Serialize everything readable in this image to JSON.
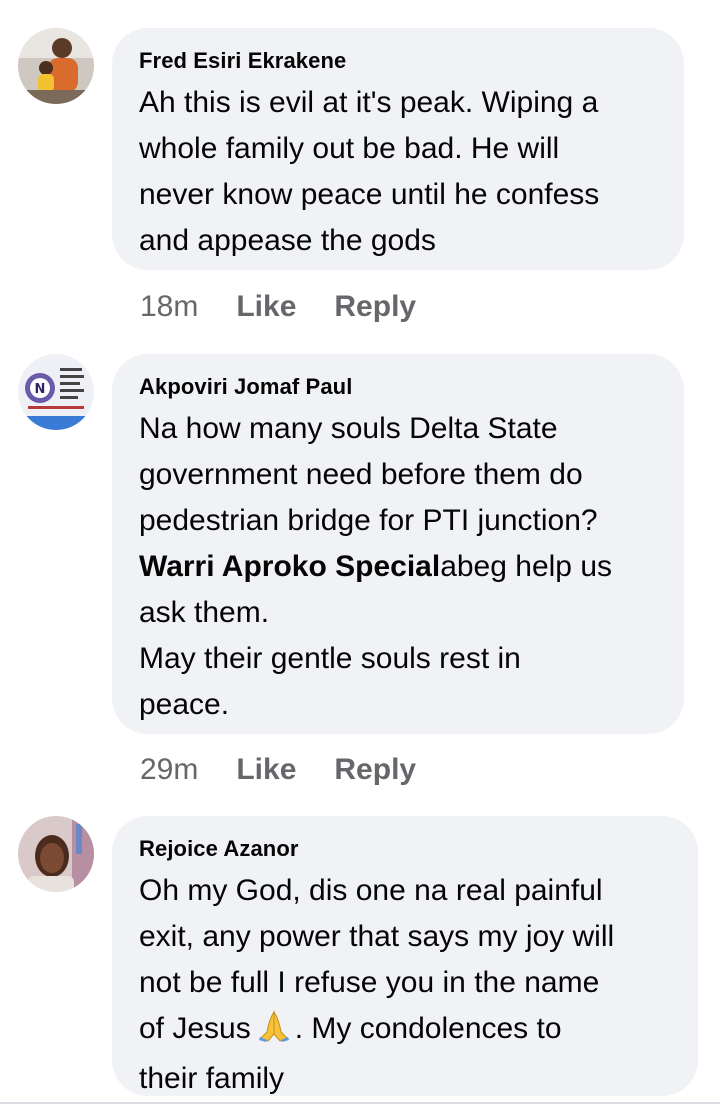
{
  "comments": [
    {
      "author": "Fred Esiri Ekrakene",
      "lines": [
        "Ah this is evil at it's peak. Wiping a",
        "whole family out be bad. He will",
        "never know peace until he confess",
        "and appease the gods"
      ],
      "time": "18m",
      "like_label": "Like",
      "reply_label": "Reply"
    },
    {
      "author": "Akpoviri Jomaf Paul",
      "lines": [
        "Na how many souls Delta State",
        "government need before them do",
        "pedestrian bridge for PTI junction?"
      ],
      "mention": "Warri Aproko Special",
      "mention_suffix": "abeg help us",
      "lines_after": [
        "ask them.",
        "May their gentle souls rest in",
        "peace."
      ],
      "time": "29m",
      "like_label": "Like",
      "reply_label": "Reply"
    },
    {
      "author": "Rejoice Azanor",
      "lines": [
        "Oh my God, dis one na  real painful",
        "exit, any power that says my joy will",
        "not be  full I refuse you in the name"
      ],
      "line4_before_emoji": "of Jesus",
      "line4_after_emoji": ". My condolences to",
      "line5": "their family"
    }
  ],
  "icons": {
    "avatar_1": "person-photo-avatar",
    "avatar_2": "logo-avatar",
    "avatar_3": "person-photo-avatar",
    "emoji": "folded-hands-emoji"
  },
  "colors": {
    "bubble": "#f0f2f5",
    "text": "#050505",
    "meta": "#65676b"
  }
}
